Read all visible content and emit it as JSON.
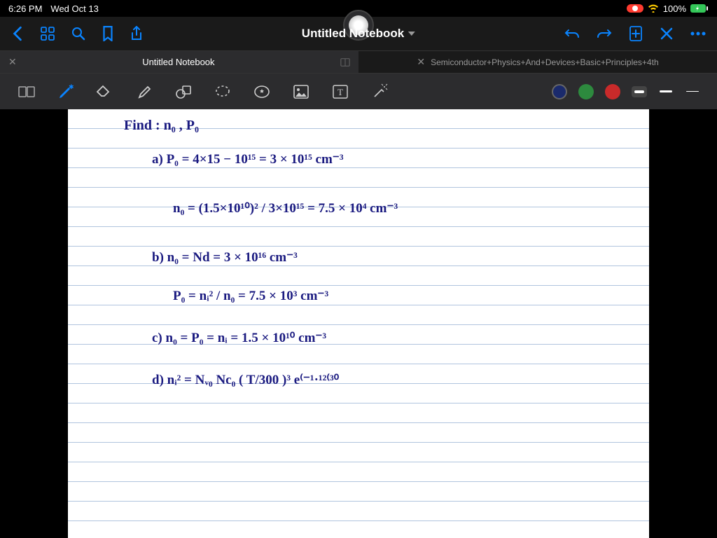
{
  "status": {
    "time": "6:26 PM",
    "date": "Wed Oct 13",
    "battery": "100%",
    "wifi_color": "#ffcc00"
  },
  "nav": {
    "title": "Untitled Notebook"
  },
  "tabs": {
    "active_label": "Untitled Notebook",
    "secondary_label": "Semiconductor+Physics+And+Devices+Basic+Principles+4th"
  },
  "colors": {
    "selected": "#1a2a6c",
    "green": "#2d8a3e",
    "red": "#c92a2a"
  },
  "handwriting": {
    "line1": "Find :      n₀ , P₀",
    "line2a": "a)   P₀ = 4×15 − 10¹⁵  =   3 × 10¹⁵  cm⁻³",
    "line3": "n₀ = (1.5×10¹⁰)² / 3×10¹⁵ =  7.5 × 10⁴  cm⁻³",
    "line4": "b)   n₀ = Nd = 3 × 10¹⁶  cm⁻³",
    "line5": "P₀ =  nᵢ² / n₀  =  7.5 × 10³  cm⁻³",
    "line6": "c)   n₀ = P₀ = nᵢ = 1.5 × 10¹⁰  cm⁻³",
    "line7": "d)   nᵢ² = Nᵥ₀ Nc₀ ( T/300 )³  e⁽⁻¹·¹²⁽³⁰"
  }
}
